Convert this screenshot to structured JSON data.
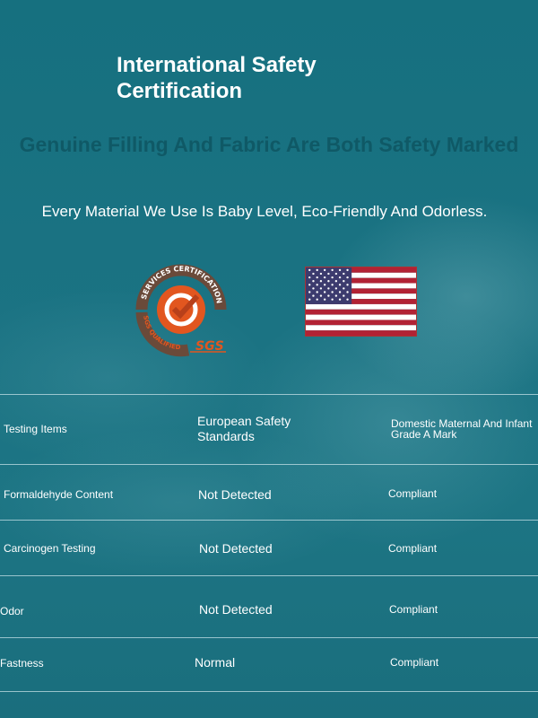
{
  "header": {
    "title": "International Safety Certification",
    "watermark": "Genuine Filling And Fabric Are Both Safety Marked",
    "subtitle": "Every Material We Use Is Baby Level, Eco-Friendly And Odorless."
  },
  "badges": {
    "sgs_ring_top": "SERVICES CERTIFICATION",
    "sgs_ring_bottom": "SGS QUALIFIED",
    "sgs_name": "SGS",
    "flag_icon": "us-flag-icon"
  },
  "table": {
    "headers": [
      "Testing Items",
      "European Safety Standards",
      "Domestic Maternal And Infant Grade A Mark"
    ],
    "rows": [
      [
        "Formaldehyde Content",
        "Not Detected",
        "Compliant"
      ],
      [
        "Carcinogen Testing",
        "Not Detected",
        "Compliant"
      ],
      [
        "Odor",
        "Not Detected",
        "Compliant"
      ],
      [
        "Fastness",
        "Normal",
        "Compliant"
      ]
    ]
  },
  "colors": {
    "background": "#1a6f80",
    "text": "#ffffff",
    "sgs_orange": "#e2561f",
    "flag_red": "#b22234",
    "flag_blue": "#3c3b6e"
  }
}
